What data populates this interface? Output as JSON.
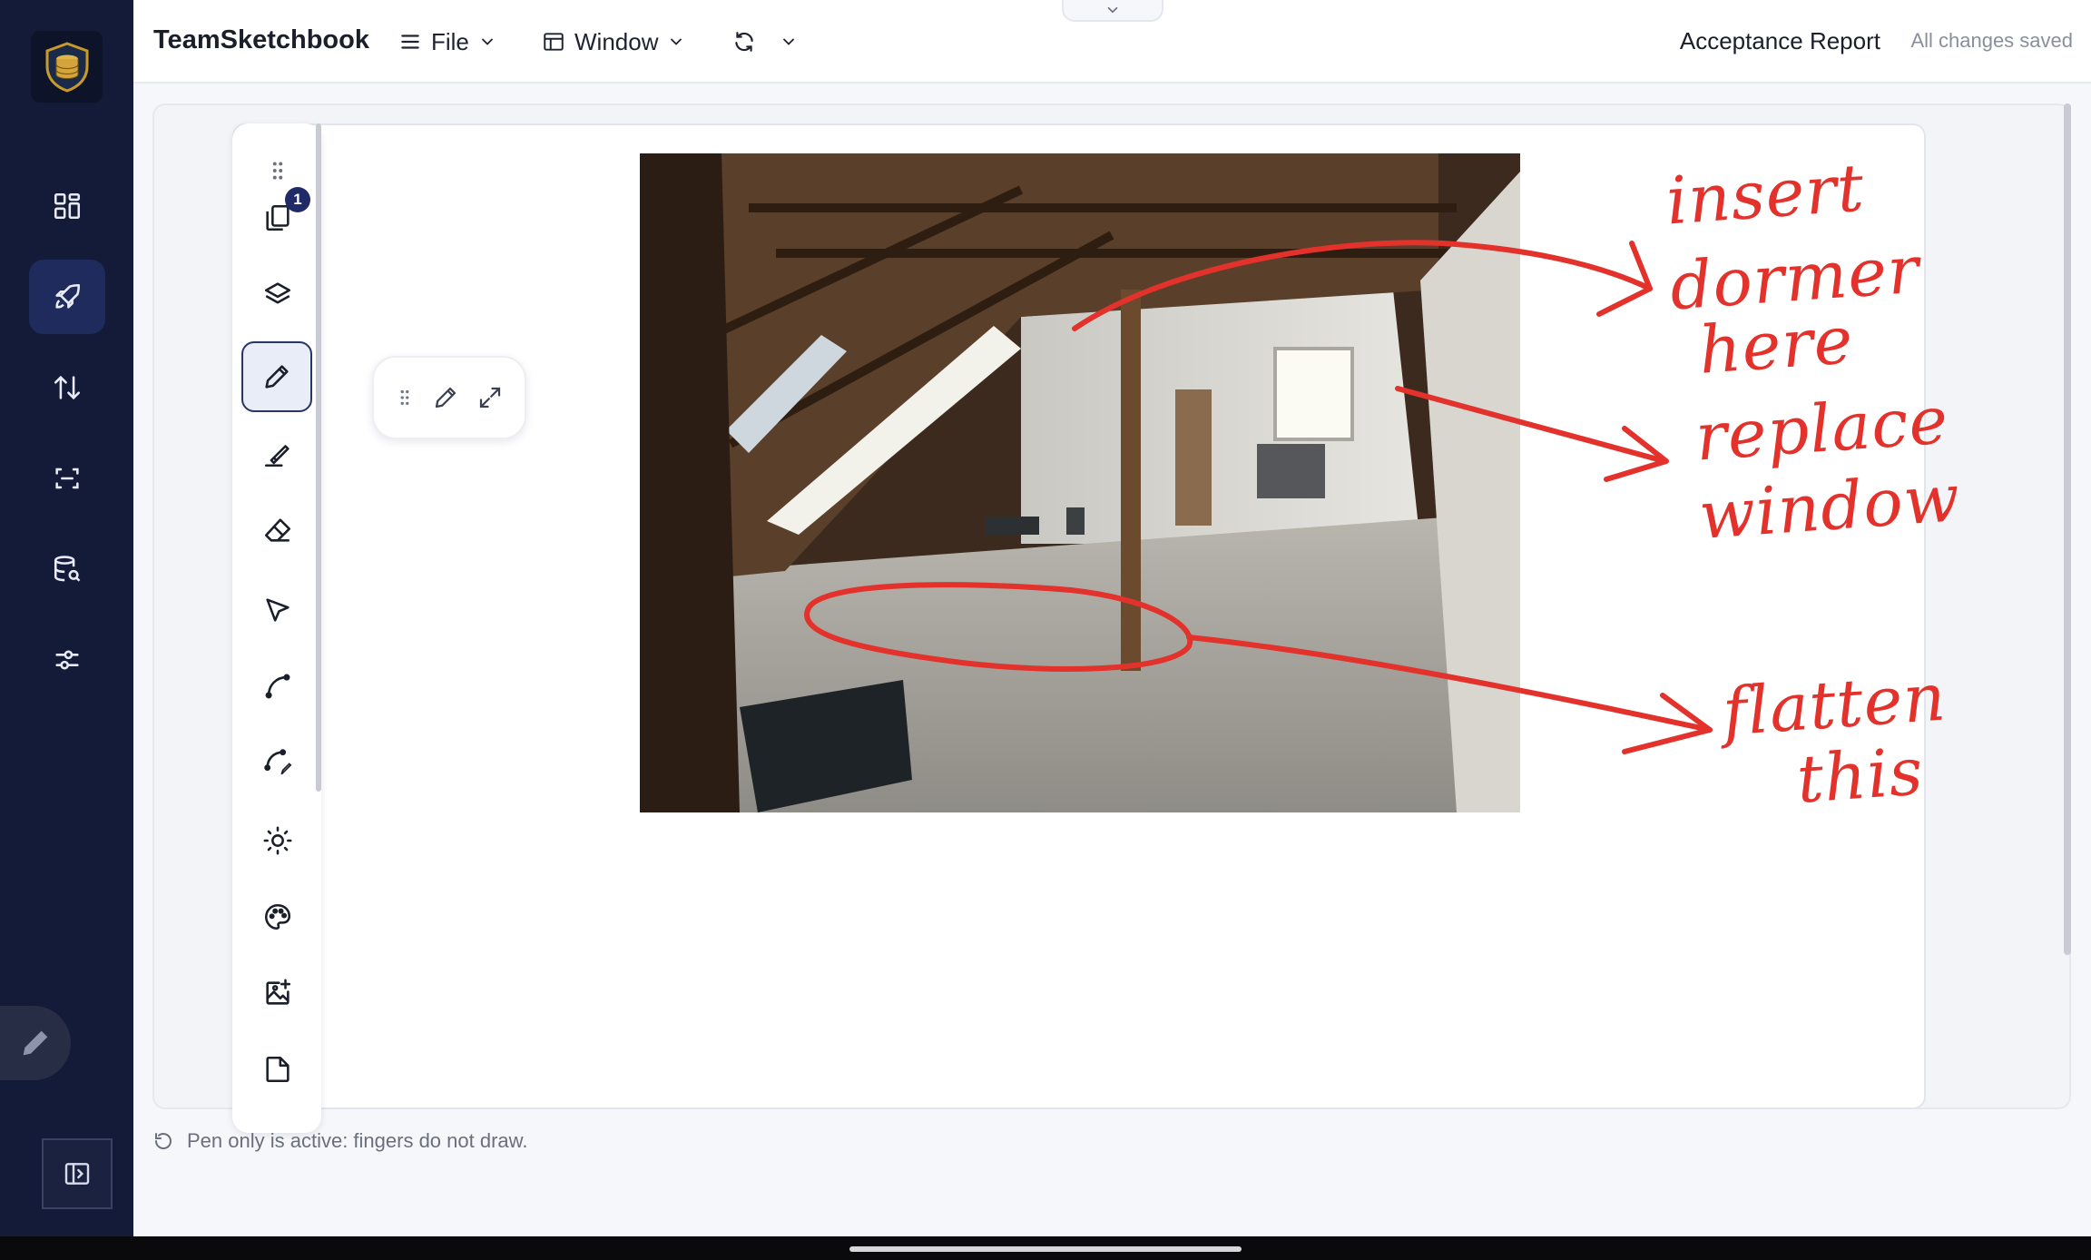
{
  "app": {
    "title": "TeamSketchbook"
  },
  "header": {
    "menu_file": "File",
    "menu_window": "Window",
    "document_title": "Acceptance Report",
    "save_status": "All changes saved"
  },
  "rail": {
    "items": [
      {
        "icon": "dashboard-icon",
        "active": false
      },
      {
        "icon": "rocket-icon",
        "active": true
      },
      {
        "icon": "sort-arrows-icon",
        "active": false
      },
      {
        "icon": "scan-icon",
        "active": false
      },
      {
        "icon": "database-search-icon",
        "active": false
      },
      {
        "icon": "sliders-icon",
        "active": false
      }
    ]
  },
  "palette": {
    "pages_badge": "1",
    "tools": [
      "grip-icon",
      "pages-icon",
      "layers-icon",
      "pen-icon",
      "highlighter-icon",
      "eraser-icon",
      "select-pointer-icon",
      "curve-icon",
      "curve-edit-icon",
      "brightness-icon",
      "palette-icon",
      "add-image-icon",
      "blank-page-icon"
    ],
    "active_tool": "pen-icon"
  },
  "annotations": {
    "note1_line1": "insert",
    "note1_line2": "dormer",
    "note1_line3": "here",
    "note2_line1": "replace",
    "note2_line2": "window",
    "note3_line1": "flatten",
    "note3_line2": "this",
    "stroke_color": "#e3312b"
  },
  "footer": {
    "note": "Pen only is active: fingers do not draw."
  }
}
